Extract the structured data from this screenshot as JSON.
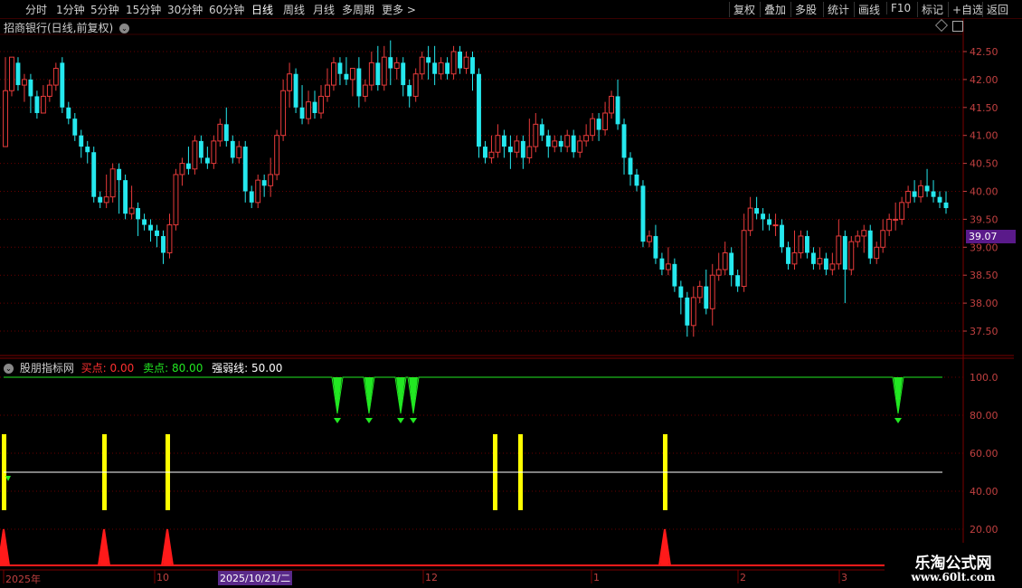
{
  "toolbar": {
    "periods": [
      "分时",
      "1分钟",
      "5分钟",
      "15分钟",
      "30分钟",
      "60分钟",
      "日线",
      "周线",
      "月线",
      "多周期",
      "更多 >"
    ],
    "active_period": "日线",
    "actions": [
      "复权",
      "叠加",
      "多股",
      "统计",
      "画线",
      "F10",
      "标记",
      "+自选",
      "返回"
    ]
  },
  "stock": {
    "title": "招商银行(日线,前复权)"
  },
  "price_axis": {
    "ticks": [
      "42.50",
      "42.00",
      "41.50",
      "41.00",
      "40.50",
      "40.00",
      "39.50",
      "39.00",
      "38.50",
      "38.00",
      "37.50"
    ],
    "current_price": "39.07"
  },
  "indicator": {
    "name": "股朋指标网",
    "buy_label": "买点:",
    "buy_value": "0.00",
    "sell_label": "卖点:",
    "sell_value": "80.00",
    "strength_label": "强弱线:",
    "strength_value": "50.00",
    "axis_ticks": [
      "100.0",
      "80.00",
      "60.00",
      "40.00",
      "20.00"
    ]
  },
  "time_axis": {
    "labels": [
      "2025年",
      "10",
      "12",
      "1",
      "2",
      "3"
    ],
    "highlighted_date": "2025/10/21/二"
  },
  "watermark": {
    "site_name": "乐淘公式网",
    "url": "www.60lt.com"
  },
  "colors": {
    "up": "#e83b3b",
    "down": "#25e8ee",
    "buy_signal": "#ff1a1a",
    "sell_signal": "#22e822",
    "strength_bar": "#ffff00",
    "grid": "#6a0000"
  },
  "chart_data": {
    "type": "candlestick",
    "ylim": [
      37.25,
      42.75
    ],
    "candles": [
      [
        40.8,
        41.8,
        40.8,
        42.4
      ],
      [
        41.8,
        42.4,
        41.7,
        42.4
      ],
      [
        42.3,
        41.9,
        41.8,
        42.4
      ],
      [
        41.9,
        42.0,
        41.6,
        42.1
      ],
      [
        42.0,
        41.7,
        41.4,
        42.1
      ],
      [
        41.7,
        41.4,
        41.3,
        41.8
      ],
      [
        41.4,
        41.7,
        41.4,
        41.9
      ],
      [
        41.7,
        41.9,
        41.6,
        42.0
      ],
      [
        41.9,
        42.2,
        41.8,
        42.3
      ],
      [
        42.3,
        41.5,
        41.4,
        42.4
      ],
      [
        41.5,
        41.3,
        41.2,
        41.6
      ],
      [
        41.3,
        41.0,
        40.9,
        41.4
      ],
      [
        41.0,
        40.8,
        40.6,
        41.1
      ],
      [
        40.8,
        40.7,
        40.5,
        40.9
      ],
      [
        40.7,
        39.9,
        39.8,
        40.8
      ],
      [
        39.9,
        39.8,
        39.7,
        40.0
      ],
      [
        39.8,
        39.9,
        39.7,
        40.3
      ],
      [
        39.9,
        40.4,
        39.8,
        40.5
      ],
      [
        40.4,
        40.2,
        39.6,
        40.5
      ],
      [
        40.2,
        39.6,
        39.5,
        40.3
      ],
      [
        39.6,
        39.7,
        39.5,
        40.1
      ],
      [
        39.7,
        39.5,
        39.2,
        39.8
      ],
      [
        39.5,
        39.4,
        39.3,
        39.6
      ],
      [
        39.4,
        39.3,
        39.1,
        39.5
      ],
      [
        39.3,
        39.2,
        39.0,
        39.4
      ],
      [
        39.2,
        38.9,
        38.7,
        39.3
      ],
      [
        38.9,
        39.4,
        38.8,
        39.6
      ],
      [
        39.4,
        40.3,
        39.3,
        40.4
      ],
      [
        40.3,
        40.5,
        40.1,
        40.6
      ],
      [
        40.5,
        40.4,
        40.3,
        40.8
      ],
      [
        40.4,
        40.9,
        40.3,
        41.0
      ],
      [
        40.9,
        40.6,
        40.5,
        41.0
      ],
      [
        40.6,
        40.5,
        40.4,
        40.8
      ],
      [
        40.5,
        40.9,
        40.4,
        41.0
      ],
      [
        40.9,
        41.2,
        40.8,
        41.3
      ],
      [
        41.2,
        40.9,
        40.8,
        41.5
      ],
      [
        40.9,
        40.6,
        40.5,
        41.0
      ],
      [
        40.6,
        40.8,
        40.5,
        40.9
      ],
      [
        40.8,
        40.0,
        39.8,
        40.9
      ],
      [
        40.0,
        39.8,
        39.7,
        40.1
      ],
      [
        39.8,
        40.2,
        39.7,
        40.3
      ],
      [
        40.2,
        40.1,
        39.9,
        40.3
      ],
      [
        40.1,
        40.3,
        39.9,
        40.6
      ],
      [
        40.3,
        41.0,
        40.2,
        41.1
      ],
      [
        41.0,
        41.8,
        40.9,
        42.0
      ],
      [
        41.8,
        42.1,
        41.5,
        42.3
      ],
      [
        42.1,
        41.5,
        41.4,
        42.2
      ],
      [
        41.5,
        41.3,
        41.2,
        41.9
      ],
      [
        41.3,
        41.6,
        41.2,
        41.8
      ],
      [
        41.6,
        41.4,
        41.3,
        41.8
      ],
      [
        41.4,
        41.7,
        41.3,
        41.9
      ],
      [
        41.7,
        41.9,
        41.6,
        42.2
      ],
      [
        41.9,
        42.3,
        41.8,
        42.4
      ],
      [
        42.3,
        42.1,
        41.9,
        42.4
      ],
      [
        42.1,
        42.0,
        41.9,
        42.4
      ],
      [
        42.0,
        42.2,
        41.7,
        42.2
      ],
      [
        42.2,
        41.7,
        41.5,
        42.4
      ],
      [
        41.7,
        41.9,
        41.6,
        42.0
      ],
      [
        41.9,
        42.3,
        41.8,
        42.5
      ],
      [
        42.3,
        41.9,
        41.8,
        42.6
      ],
      [
        41.9,
        42.4,
        41.8,
        42.6
      ],
      [
        42.4,
        42.2,
        41.9,
        42.7
      ],
      [
        42.2,
        42.3,
        42.0,
        42.4
      ],
      [
        42.3,
        41.9,
        41.7,
        42.4
      ],
      [
        41.9,
        41.7,
        41.5,
        42.0
      ],
      [
        41.7,
        42.1,
        41.6,
        42.2
      ],
      [
        42.1,
        42.4,
        42.0,
        42.5
      ],
      [
        42.4,
        42.3,
        42.0,
        42.6
      ],
      [
        42.3,
        42.1,
        41.9,
        42.6
      ],
      [
        42.1,
        42.3,
        42.0,
        42.4
      ],
      [
        42.3,
        42.1,
        42.0,
        42.4
      ],
      [
        42.1,
        42.5,
        42.0,
        42.6
      ],
      [
        42.5,
        42.2,
        42.1,
        42.6
      ],
      [
        42.2,
        42.4,
        42.1,
        42.5
      ],
      [
        42.4,
        42.1,
        41.8,
        42.5
      ],
      [
        42.1,
        40.8,
        40.6,
        42.2
      ],
      [
        40.8,
        40.6,
        40.5,
        40.9
      ],
      [
        40.6,
        40.7,
        40.5,
        41.0
      ],
      [
        40.7,
        41.0,
        40.6,
        41.2
      ],
      [
        41.0,
        40.8,
        40.6,
        41.1
      ],
      [
        40.8,
        40.7,
        40.4,
        41.0
      ],
      [
        40.7,
        40.9,
        40.6,
        41.0
      ],
      [
        40.9,
        40.6,
        40.4,
        41.0
      ],
      [
        40.6,
        40.8,
        40.5,
        41.3
      ],
      [
        40.8,
        41.2,
        40.7,
        41.4
      ],
      [
        41.2,
        41.0,
        40.9,
        41.3
      ],
      [
        41.0,
        40.8,
        40.6,
        41.1
      ],
      [
        40.8,
        40.9,
        40.7,
        41.0
      ],
      [
        40.9,
        40.8,
        40.7,
        41.0
      ],
      [
        40.8,
        41.0,
        40.7,
        41.1
      ],
      [
        41.0,
        40.7,
        40.6,
        41.1
      ],
      [
        40.7,
        40.9,
        40.6,
        41.0
      ],
      [
        40.9,
        41.0,
        40.8,
        41.2
      ],
      [
        41.0,
        41.3,
        40.9,
        41.4
      ],
      [
        41.3,
        41.1,
        40.9,
        41.4
      ],
      [
        41.1,
        41.4,
        41.0,
        41.6
      ],
      [
        41.4,
        41.7,
        41.3,
        41.8
      ],
      [
        41.7,
        41.2,
        41.1,
        42.0
      ],
      [
        41.2,
        40.6,
        40.3,
        41.3
      ],
      [
        40.6,
        40.3,
        40.1,
        40.7
      ],
      [
        40.3,
        40.1,
        40.0,
        40.4
      ],
      [
        40.1,
        39.1,
        39.0,
        40.2
      ],
      [
        39.1,
        39.2,
        39.0,
        39.3
      ],
      [
        39.2,
        38.8,
        38.7,
        39.4
      ],
      [
        38.8,
        38.6,
        38.5,
        38.9
      ],
      [
        38.6,
        38.7,
        38.5,
        39.0
      ],
      [
        38.7,
        38.3,
        38.2,
        38.8
      ],
      [
        38.3,
        38.1,
        37.8,
        38.4
      ],
      [
        38.1,
        37.6,
        37.4,
        38.2
      ],
      [
        37.6,
        38.1,
        37.4,
        38.3
      ],
      [
        38.1,
        38.3,
        38.0,
        38.4
      ],
      [
        38.3,
        37.9,
        37.8,
        38.6
      ],
      [
        37.9,
        38.5,
        37.6,
        38.7
      ],
      [
        38.5,
        38.6,
        38.4,
        38.9
      ],
      [
        38.6,
        38.9,
        38.5,
        39.1
      ],
      [
        38.9,
        38.5,
        38.3,
        39.0
      ],
      [
        38.5,
        38.3,
        38.2,
        38.6
      ],
      [
        38.3,
        39.3,
        38.2,
        39.6
      ],
      [
        39.3,
        39.7,
        39.2,
        39.9
      ],
      [
        39.7,
        39.6,
        39.5,
        39.9
      ],
      [
        39.6,
        39.5,
        39.3,
        39.7
      ],
      [
        39.5,
        39.4,
        39.3,
        39.6
      ],
      [
        39.4,
        39.4,
        39.2,
        39.6
      ],
      [
        39.4,
        39.0,
        38.9,
        39.5
      ],
      [
        39.0,
        38.7,
        38.6,
        39.1
      ],
      [
        38.7,
        38.9,
        38.6,
        39.3
      ],
      [
        38.9,
        39.2,
        38.8,
        39.3
      ],
      [
        39.2,
        38.9,
        38.8,
        39.3
      ],
      [
        38.9,
        38.7,
        38.6,
        39.0
      ],
      [
        38.7,
        38.8,
        38.6,
        39.0
      ],
      [
        38.8,
        38.6,
        38.5,
        38.9
      ],
      [
        38.6,
        38.7,
        38.5,
        38.9
      ],
      [
        38.7,
        39.2,
        38.6,
        39.5
      ],
      [
        39.2,
        38.6,
        38.0,
        39.3
      ],
      [
        38.6,
        39.1,
        38.5,
        39.2
      ],
      [
        39.1,
        39.2,
        39.0,
        39.3
      ],
      [
        39.2,
        39.3,
        38.9,
        39.4
      ],
      [
        39.3,
        38.8,
        38.7,
        39.4
      ],
      [
        38.8,
        39.0,
        38.7,
        39.1
      ],
      [
        39.0,
        39.3,
        38.9,
        39.5
      ],
      [
        39.3,
        39.5,
        39.2,
        39.6
      ],
      [
        39.5,
        39.5,
        39.3,
        39.8
      ],
      [
        39.5,
        39.8,
        39.4,
        39.9
      ],
      [
        39.8,
        40.0,
        39.7,
        40.1
      ],
      [
        40.0,
        39.9,
        39.8,
        40.2
      ],
      [
        39.9,
        40.1,
        39.8,
        40.2
      ],
      [
        40.1,
        40.0,
        39.9,
        40.4
      ],
      [
        40.0,
        39.9,
        39.8,
        40.2
      ],
      [
        39.9,
        39.8,
        39.7,
        40.0
      ],
      [
        39.8,
        39.7,
        39.6,
        40.0
      ]
    ],
    "indicator_series": {
      "buy_points": [
        0,
        16,
        26,
        105,
        0
      ],
      "sell_points": [
        53,
        58,
        63,
        65,
        142
      ],
      "strength_bars": [
        0,
        16,
        26,
        78,
        82,
        105
      ],
      "sell_line": 100,
      "buy_line": 0,
      "strength_line": 50
    }
  }
}
